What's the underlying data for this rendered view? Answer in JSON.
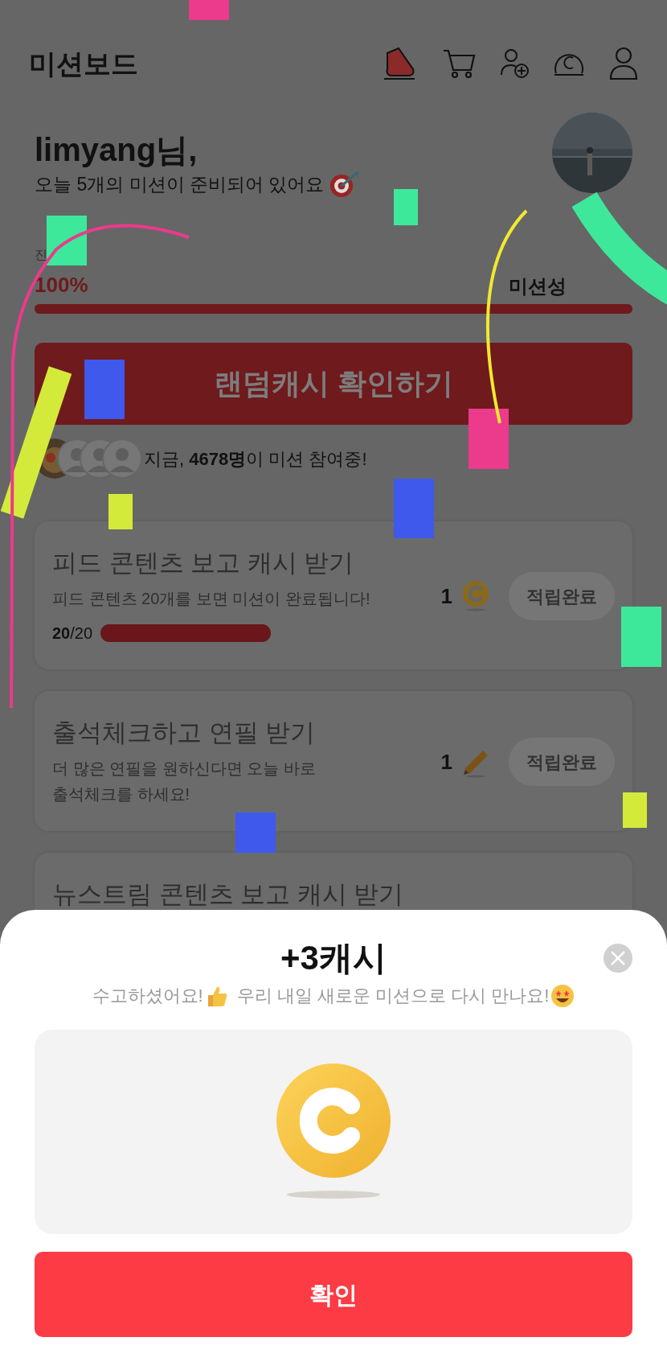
{
  "header": {
    "title": "미션보드"
  },
  "greeting": {
    "name": "limyang님,",
    "subtitle": "오늘 5개의 미션이 준비되어 있어요"
  },
  "progress": {
    "label": "진",
    "percent": "100%",
    "goal_label": "미션성",
    "level": 1
  },
  "random_button": {
    "label": "랜덤캐시 확인하기"
  },
  "participants": {
    "text": "지금, **4678명**이 미션 참여중!"
  },
  "missions": [
    {
      "title": "피드 콘텐츠 보고 캐시 받기",
      "description": "피드 콘텐츠 20개를 보면 미션이 완료됩니다!",
      "reward": "1",
      "kind": "cash",
      "button": "적립완료",
      "completed": true,
      "count": "**20**/20",
      "level": 1
    },
    {
      "title": "출석체크하고 연필 받기",
      "description": "더 많은 연필을 원하신다면 오늘 바로 출석체크를 하세요!",
      "reward": "1",
      "kind": "pencil",
      "button": "적립완료",
      "completed": true
    },
    {
      "title": "뉴스트림 콘텐츠 보고 캐시 받기"
    }
  ],
  "sheet": {
    "title": "+3캐시",
    "message_start": "수고하셨어요!",
    "message_end": "우리 내일 새로운 미션으로 다시 만나요!",
    "confirm": "확인"
  }
}
